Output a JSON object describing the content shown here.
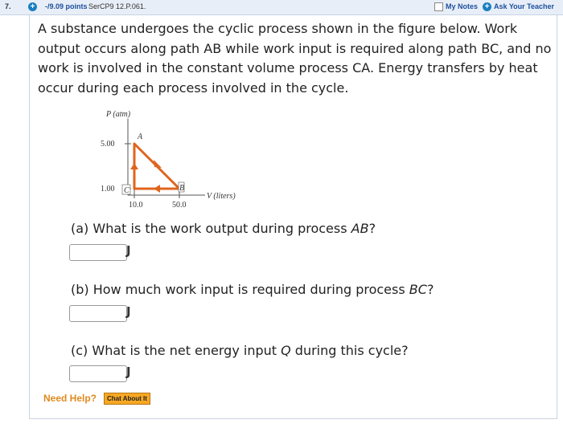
{
  "header": {
    "question_number": "7.",
    "points": "-/9.09 points",
    "source": "SerCP9 12.P.061.",
    "my_notes": "My Notes",
    "ask_teacher": "Ask Your Teacher"
  },
  "prompt": "A substance undergoes the cyclic process shown in the figure below. Work output occurs along path AB while work input is required along path BC, and no work is involved in the constant volume process CA. Energy transfers by heat occur during each process involved in the cycle.",
  "figure": {
    "y_axis_label": "P (atm)",
    "x_axis_label": "V (liters)",
    "y_ticks": [
      "5.00",
      "1.00"
    ],
    "x_ticks": [
      "10.0",
      "50.0"
    ],
    "points": {
      "A": "A",
      "B": "B",
      "C": "C"
    },
    "path_color": "#e0641e"
  },
  "questions": [
    {
      "label_pre": "(a) What is the work output during process ",
      "label_var": "AB",
      "label_post": "?",
      "unit": "J",
      "value": ""
    },
    {
      "label_pre": "(b) How much work input is required during process ",
      "label_var": "BC",
      "label_post": "?",
      "unit": "J",
      "value": ""
    },
    {
      "label_pre": "(c) What is the net energy input ",
      "label_var": "Q",
      "label_post": " during this cycle?",
      "unit": "J",
      "value": ""
    }
  ],
  "help": {
    "need_help": "Need Help?",
    "chat_button": "Chat About It"
  }
}
